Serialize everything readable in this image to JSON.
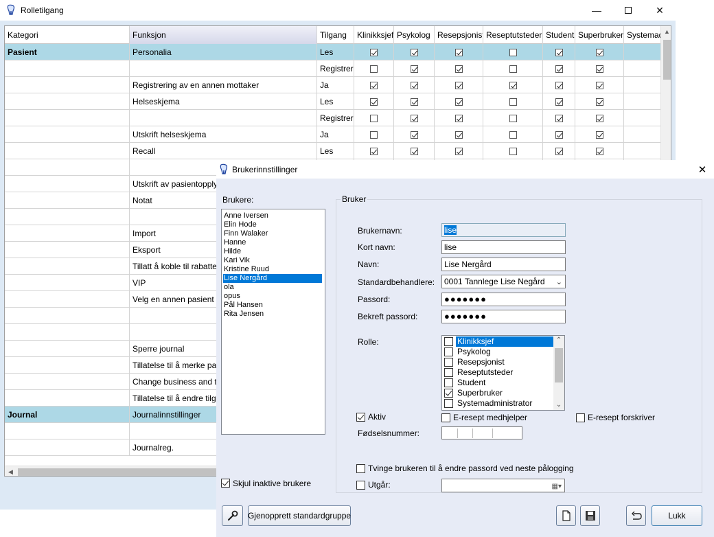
{
  "rolletilgang": {
    "title": "Rolletilgang",
    "columns": [
      "Kategori",
      "Funksjon",
      "Tilgang",
      "Klinikksjef",
      "Psykolog",
      "Resepsjonist",
      "Reseptutsteder",
      "Student",
      "Superbruker",
      "Systemadministrator"
    ],
    "rows": [
      {
        "kategori": "Pasient",
        "funksjon": "Personalia",
        "tilgang": "Les",
        "checks": [
          true,
          true,
          true,
          false,
          true,
          true
        ],
        "category_row": true
      },
      {
        "kategori": "",
        "funksjon": "",
        "tilgang": "Registrer",
        "checks": [
          false,
          true,
          true,
          false,
          true,
          true
        ]
      },
      {
        "kategori": "",
        "funksjon": "Registrering av en annen mottaker",
        "tilgang": "Ja",
        "checks": [
          true,
          true,
          true,
          true,
          true,
          true
        ]
      },
      {
        "kategori": "",
        "funksjon": "Helseskjema",
        "tilgang": "Les",
        "checks": [
          true,
          true,
          true,
          false,
          true,
          true
        ]
      },
      {
        "kategori": "",
        "funksjon": "",
        "tilgang": "Registrer",
        "checks": [
          false,
          true,
          true,
          false,
          true,
          true
        ]
      },
      {
        "kategori": "",
        "funksjon": "Utskrift helseskjema",
        "tilgang": "Ja",
        "checks": [
          false,
          true,
          true,
          false,
          true,
          true
        ]
      },
      {
        "kategori": "",
        "funksjon": "Recall",
        "tilgang": "Les",
        "checks": [
          true,
          true,
          true,
          false,
          true,
          true
        ]
      },
      {
        "kategori": "",
        "funksjon": "",
        "tilgang": "",
        "checks": []
      },
      {
        "kategori": "",
        "funksjon": "Utskrift av pasientopply",
        "tilgang": "",
        "checks": []
      },
      {
        "kategori": "",
        "funksjon": "Notat",
        "tilgang": "",
        "checks": []
      },
      {
        "kategori": "",
        "funksjon": "",
        "tilgang": "",
        "checks": []
      },
      {
        "kategori": "",
        "funksjon": "Import",
        "tilgang": "",
        "checks": []
      },
      {
        "kategori": "",
        "funksjon": "Eksport",
        "tilgang": "",
        "checks": []
      },
      {
        "kategori": "",
        "funksjon": "Tillatt å koble til rabatte",
        "tilgang": "",
        "checks": []
      },
      {
        "kategori": "",
        "funksjon": "VIP",
        "tilgang": "",
        "checks": []
      },
      {
        "kategori": "",
        "funksjon": "Velg en annen pasient",
        "tilgang": "",
        "checks": []
      },
      {
        "kategori": "",
        "funksjon": "",
        "tilgang": "",
        "checks": []
      },
      {
        "kategori": "",
        "funksjon": "",
        "tilgang": "",
        "checks": []
      },
      {
        "kategori": "",
        "funksjon": "Sperre journal",
        "tilgang": "",
        "checks": []
      },
      {
        "kategori": "",
        "funksjon": "Tillatelse til å merke pa",
        "tilgang": "",
        "checks": []
      },
      {
        "kategori": "",
        "funksjon": "Change business and t",
        "tilgang": "",
        "checks": []
      },
      {
        "kategori": "",
        "funksjon": "Tillatelse til å endre tilg",
        "tilgang": "",
        "checks": []
      },
      {
        "kategori": "Journal",
        "funksjon": "Journalinnstillinger",
        "tilgang": "",
        "checks": [],
        "category_row": true
      },
      {
        "kategori": "",
        "funksjon": "",
        "tilgang": "",
        "checks": []
      },
      {
        "kategori": "",
        "funksjon": "Journalreg.",
        "tilgang": "",
        "checks": []
      }
    ]
  },
  "dialog": {
    "title": "Brukerinnstillinger",
    "brukere_label": "Brukere:",
    "users": [
      "Anne Iversen",
      "Elin Hode",
      "Finn Walaker",
      "Hanne",
      "Hilde",
      "Kari Vik",
      "Kristine Ruud",
      "Lise Nergård",
      "ola",
      "opus",
      "Pål Hansen",
      "Rita Jensen"
    ],
    "selected_user": "Lise Nergård",
    "skjul_inaktive_label": "Skjul inaktive brukere",
    "skjul_inaktive_checked": true,
    "bruker_group": "Bruker",
    "fields": {
      "brukernavn_label": "Brukernavn:",
      "brukernavn_value": "lise",
      "kortnavn_label": "Kort navn:",
      "kortnavn_value": "lise",
      "navn_label": "Navn:",
      "navn_value": "Lise Nergård",
      "standardbehandlere_label": "Standardbehandlere:",
      "standardbehandlere_value": "0001 Tannlege Lise Negård",
      "passord_label": "Passord:",
      "passord_value": "●●●●●●●",
      "bekreft_label": "Bekreft passord:",
      "bekreft_value": "●●●●●●●",
      "rolle_label": "Rolle:"
    },
    "roles": [
      {
        "name": "Klinikksjef",
        "checked": false,
        "selected": true
      },
      {
        "name": "Psykolog",
        "checked": false
      },
      {
        "name": "Resepsjonist",
        "checked": false
      },
      {
        "name": "Reseptutsteder",
        "checked": false
      },
      {
        "name": "Student",
        "checked": false
      },
      {
        "name": "Superbruker",
        "checked": true
      },
      {
        "name": "Systemadministrator",
        "checked": false
      }
    ],
    "aktiv_label": "Aktiv",
    "aktiv_checked": true,
    "eresept_medhjelper_label": "E-resept medhjelper",
    "eresept_forskriver_label": "E-resept forskriver",
    "fodselsnummer_label": "Fødselsnummer:",
    "tvinge_label": "Tvinge brukeren til å endre passord ved neste pålogging",
    "utgar_label": "Utgår:",
    "buttons": {
      "gjenopprett": "Gjenopprett standardgruppe",
      "lukk": "Lukk"
    }
  }
}
